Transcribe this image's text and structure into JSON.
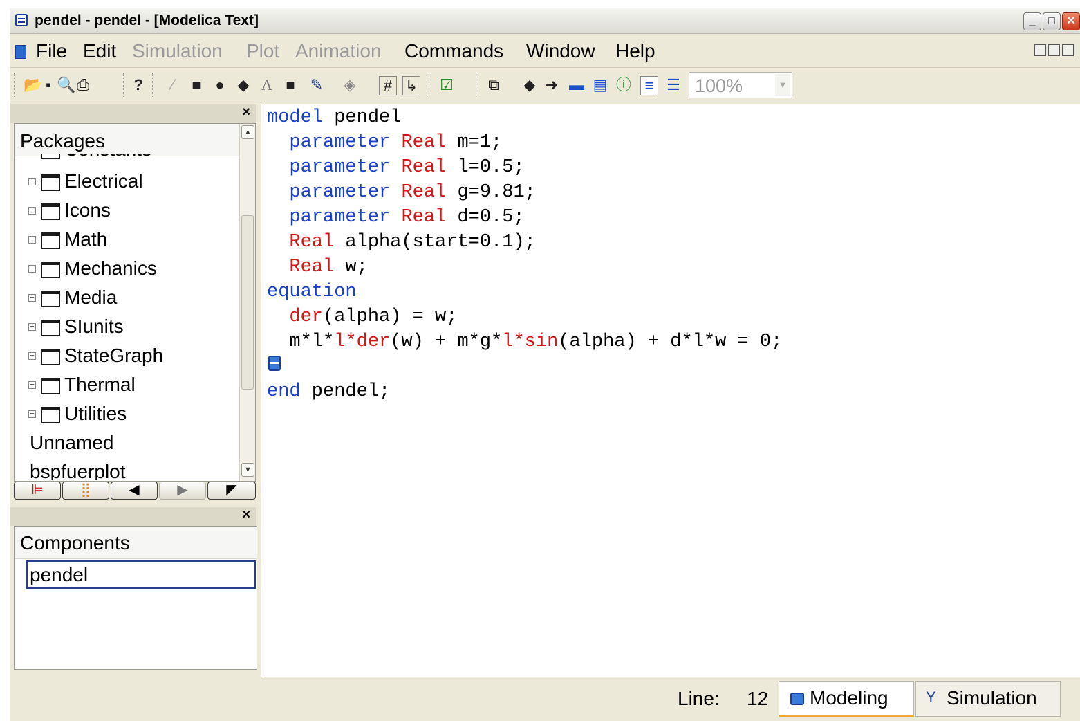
{
  "window": {
    "title": "pendel - pendel  - [Modelica Text]",
    "controls": [
      "minimize",
      "maximize",
      "close"
    ]
  },
  "menu": {
    "items": [
      {
        "label": "File",
        "enabled": true
      },
      {
        "label": "Edit",
        "enabled": true
      },
      {
        "label": "Simulation",
        "enabled": false
      },
      {
        "label": "Plot",
        "enabled": false
      },
      {
        "label": "Animation",
        "enabled": false
      },
      {
        "label": "Commands",
        "enabled": true
      },
      {
        "label": "Window",
        "enabled": true
      },
      {
        "label": "Help",
        "enabled": true
      }
    ]
  },
  "toolbar": {
    "zoom": "100%",
    "icons": [
      "open-icon",
      "save-icon",
      "search-icon",
      "print-icon",
      "whats-this-icon",
      "line-icon",
      "rectangle-icon",
      "ellipse-icon",
      "polygon-icon",
      "text-icon",
      "bitmap-icon",
      "line-color-icon",
      "fill-color-icon",
      "grid-icon",
      "connect-mode-icon",
      "check-icon",
      "library-icon",
      "back-icon",
      "forward-icon",
      "component-mode-icon",
      "diagram-mode-icon",
      "info-mode-icon",
      "modelica-text-icon",
      "documentation-icon"
    ]
  },
  "packages": {
    "title": "Packages",
    "items": [
      "Constants",
      "Electrical",
      "Icons",
      "Math",
      "Mechanics",
      "Media",
      "SIunits",
      "StateGraph",
      "Thermal",
      "Utilities",
      "Unnamed",
      "bspfuerplot"
    ]
  },
  "components": {
    "title": "Components",
    "items": [
      "pendel"
    ]
  },
  "editor": {
    "lines": [
      [
        {
          "t": "model",
          "c": "kw"
        },
        {
          "t": " pendel",
          "c": ""
        }
      ],
      [
        {
          "t": "  ",
          "c": ""
        },
        {
          "t": "parameter",
          "c": "kw"
        },
        {
          "t": " ",
          "c": ""
        },
        {
          "t": "Real",
          "c": "ty"
        },
        {
          "t": " m=1;",
          "c": ""
        }
      ],
      [
        {
          "t": "  ",
          "c": ""
        },
        {
          "t": "parameter",
          "c": "kw"
        },
        {
          "t": " ",
          "c": ""
        },
        {
          "t": "Real",
          "c": "ty"
        },
        {
          "t": " l=0.5;",
          "c": ""
        }
      ],
      [
        {
          "t": "  ",
          "c": ""
        },
        {
          "t": "parameter",
          "c": "kw"
        },
        {
          "t": " ",
          "c": ""
        },
        {
          "t": "Real",
          "c": "ty"
        },
        {
          "t": " g=9.81;",
          "c": ""
        }
      ],
      [
        {
          "t": "  ",
          "c": ""
        },
        {
          "t": "parameter",
          "c": "kw"
        },
        {
          "t": " ",
          "c": ""
        },
        {
          "t": "Real",
          "c": "ty"
        },
        {
          "t": " d=0.5;",
          "c": ""
        }
      ],
      [
        {
          "t": "  ",
          "c": ""
        },
        {
          "t": "Real",
          "c": "ty"
        },
        {
          "t": " alpha(start=0.1);",
          "c": ""
        }
      ],
      [
        {
          "t": "  ",
          "c": ""
        },
        {
          "t": "Real",
          "c": "ty"
        },
        {
          "t": " w;",
          "c": ""
        }
      ],
      [
        {
          "t": "equation",
          "c": "kw"
        }
      ],
      [
        {
          "t": "  ",
          "c": ""
        },
        {
          "t": "der",
          "c": "ty"
        },
        {
          "t": "(alpha) = w;",
          "c": ""
        }
      ],
      [
        {
          "t": "  m*l*",
          "c": ""
        },
        {
          "t": "l*der",
          "c": "ty"
        },
        {
          "t": "(w) + m*g*",
          "c": ""
        },
        {
          "t": "l*sin",
          "c": "ty"
        },
        {
          "t": "(alpha) + d*l*w = 0;",
          "c": ""
        }
      ],
      [],
      [
        {
          "t": "end",
          "c": "kw"
        },
        {
          "t": " pendel;",
          "c": ""
        }
      ]
    ]
  },
  "status": {
    "line_label": "Line:",
    "line_value": "12",
    "modes": [
      {
        "label": "Modeling",
        "active": true
      },
      {
        "label": "Simulation",
        "active": false
      }
    ]
  }
}
